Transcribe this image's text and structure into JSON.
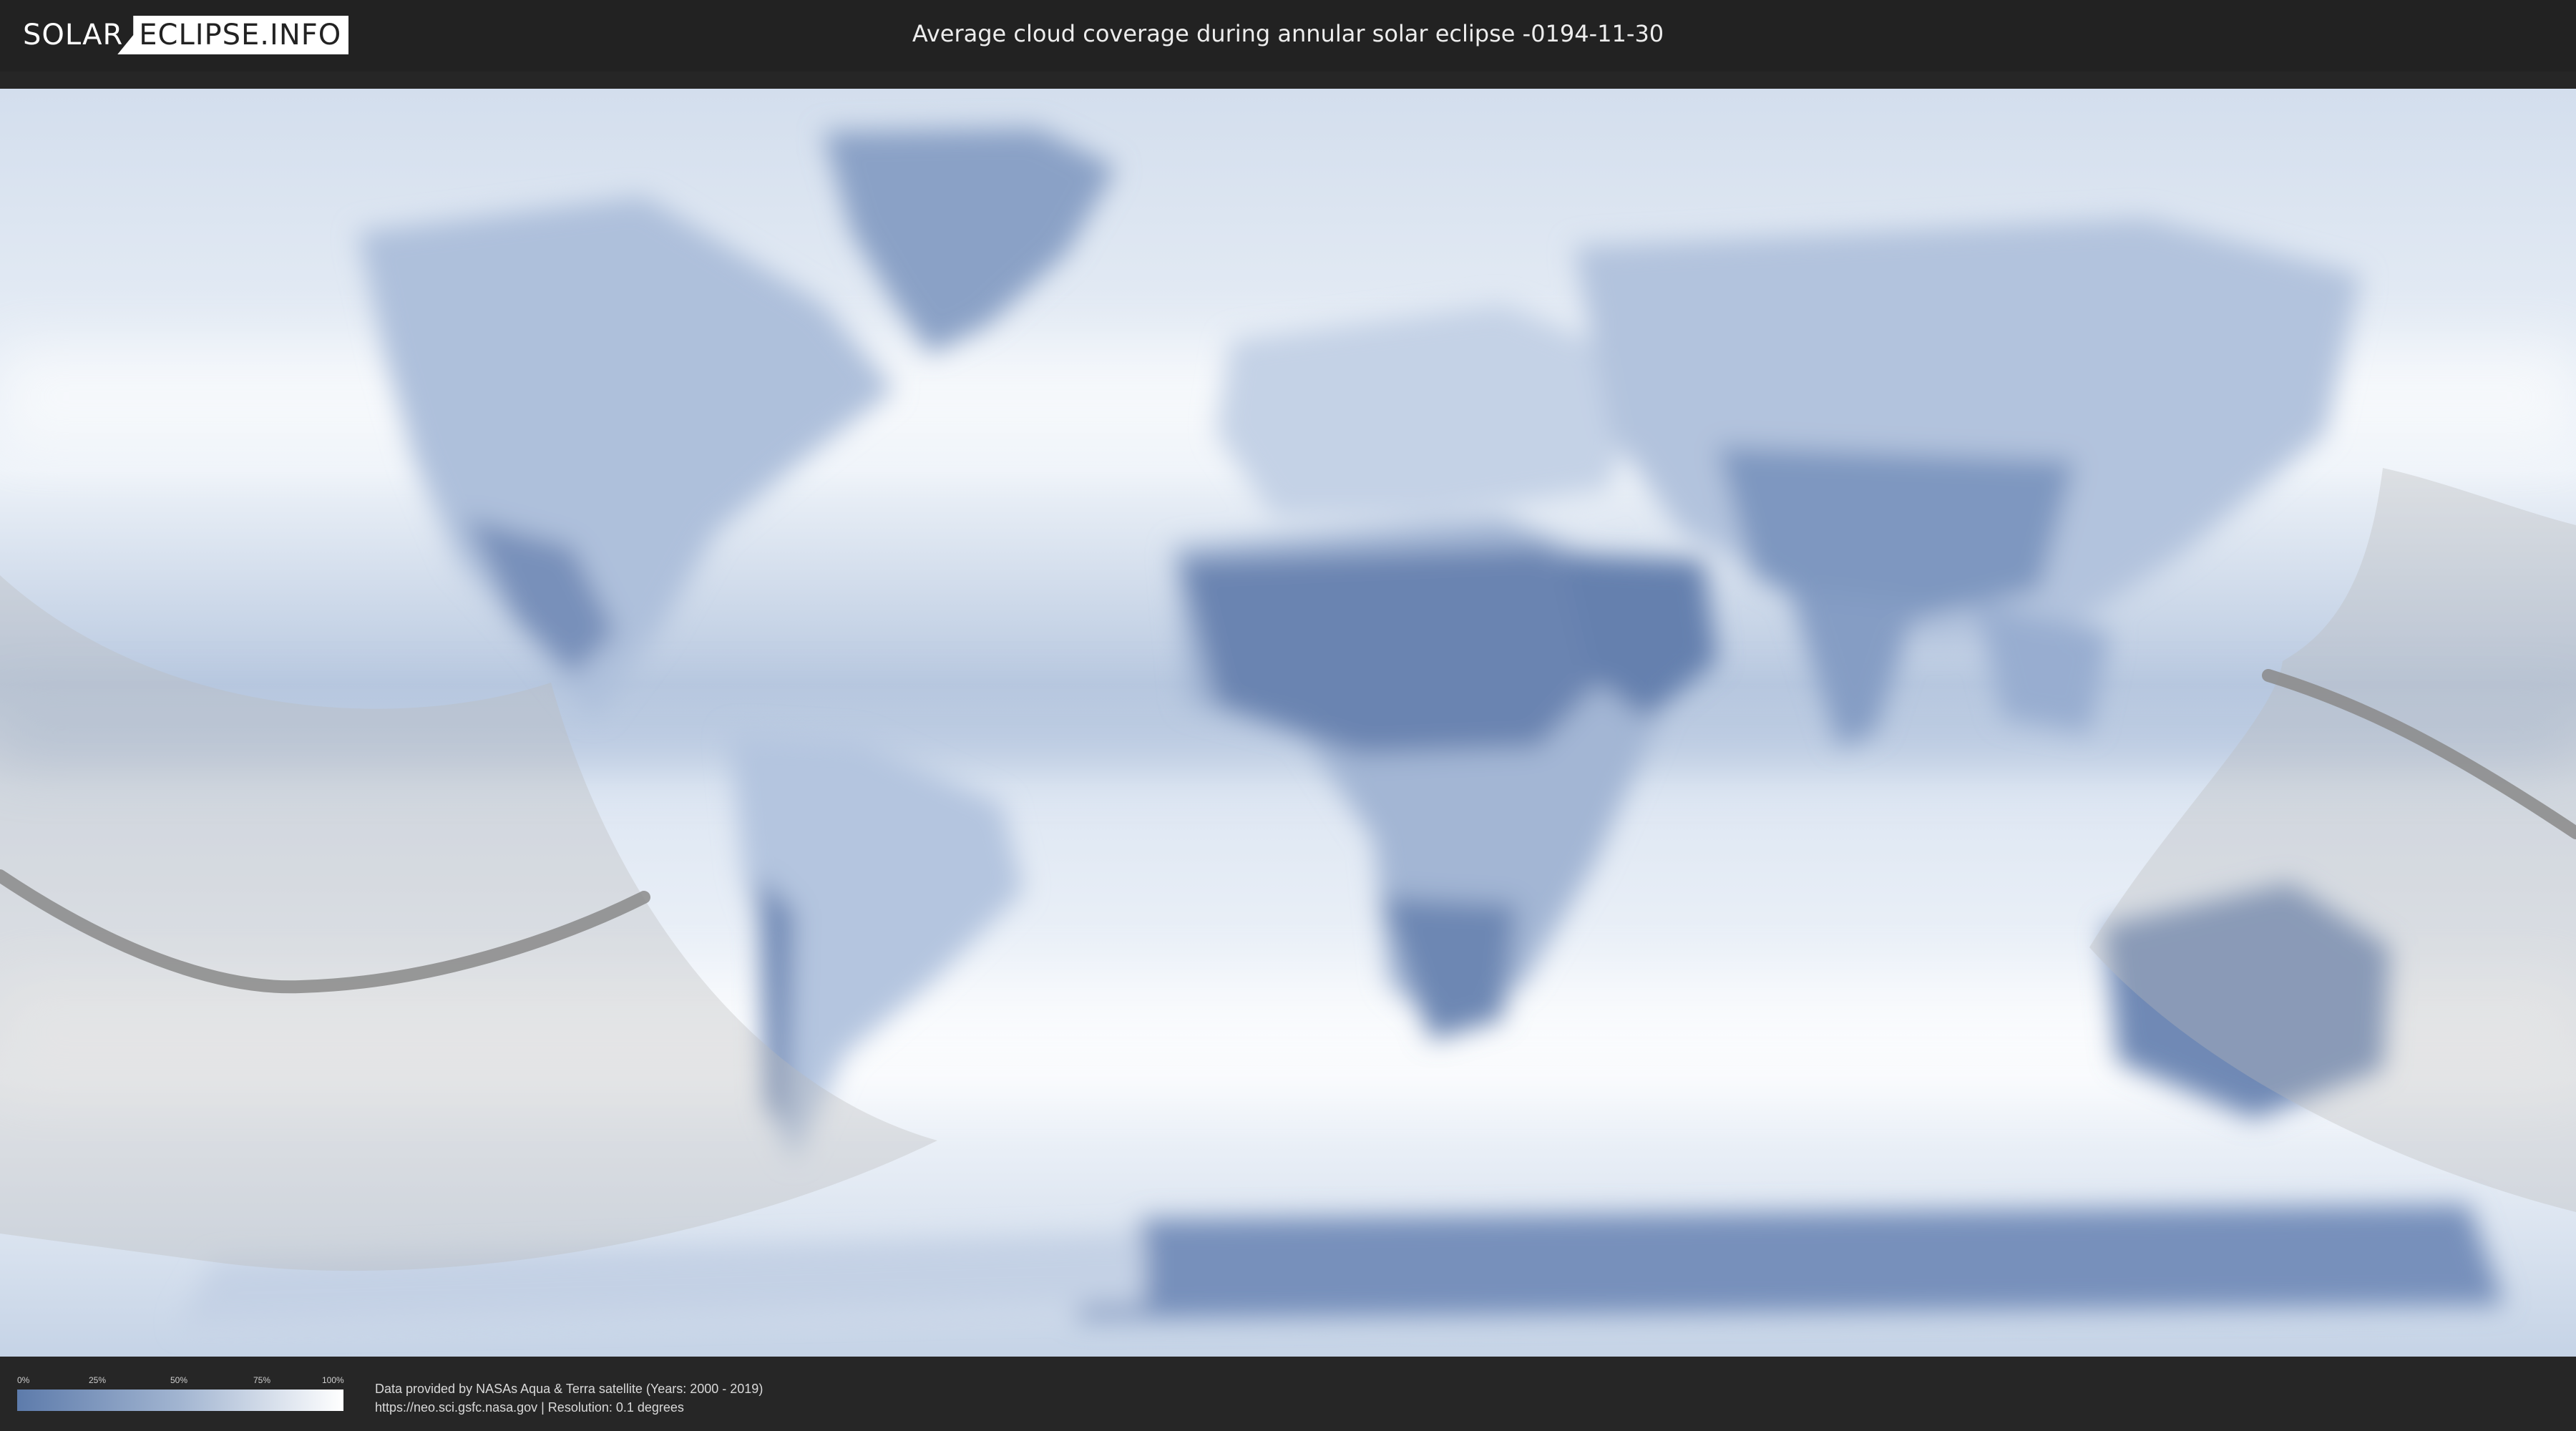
{
  "header": {
    "logo_left": "SOLAR",
    "logo_right": "ECLIPSE.INFO",
    "title": "Average cloud coverage during annular solar eclipse -0194-11-30"
  },
  "legend": {
    "ticks": [
      "0%",
      "25%",
      "50%",
      "75%",
      "100%"
    ],
    "colors": {
      "low": "#5d7bab",
      "mid": "#a2b5d1",
      "high": "#ffffff"
    }
  },
  "credits": {
    "line1": "Data provided by NASAs Aqua & Terra satellite (Years: 2000 - 2019)",
    "line2": "https://neo.sci.gsfc.nasa.gov | Resolution: 0.1 degrees"
  },
  "map": {
    "type": "equirectangular cloud coverage map",
    "ocean_color": "#e8eef6",
    "land_clear_color": "#7d96bf",
    "shadow_color": "#b9b9b9",
    "central_line_color": "#8a8a8a"
  }
}
